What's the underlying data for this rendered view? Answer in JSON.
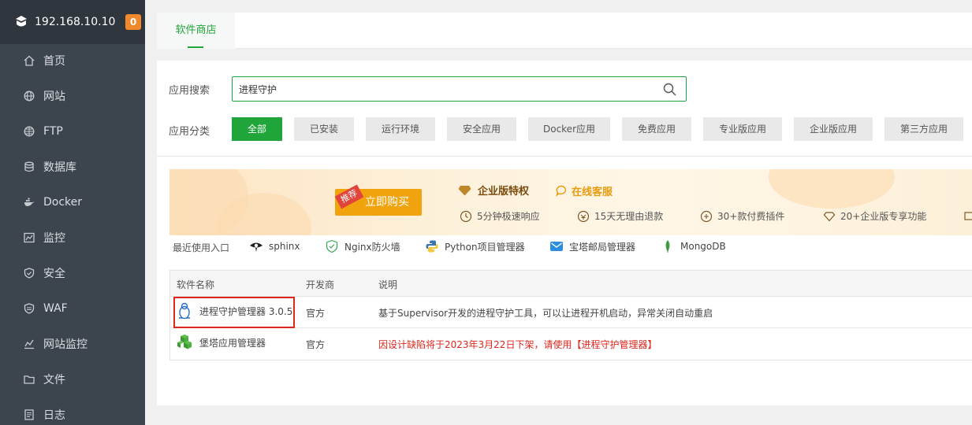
{
  "sidebar": {
    "ip": "192.168.10.10",
    "badge": "0",
    "items": [
      {
        "label": "首页",
        "icon": "home-icon"
      },
      {
        "label": "网站",
        "icon": "globe-icon"
      },
      {
        "label": "FTP",
        "icon": "ftp-globe-icon"
      },
      {
        "label": "数据库",
        "icon": "database-icon"
      },
      {
        "label": "Docker",
        "icon": "docker-icon"
      },
      {
        "label": "监控",
        "icon": "monitor-icon"
      },
      {
        "label": "安全",
        "icon": "shield-icon"
      },
      {
        "label": "WAF",
        "icon": "waf-shield-icon"
      },
      {
        "label": "网站监控",
        "icon": "chart-icon"
      },
      {
        "label": "文件",
        "icon": "folder-icon"
      },
      {
        "label": "日志",
        "icon": "log-icon"
      }
    ]
  },
  "tabs": [
    {
      "label": "软件商店"
    }
  ],
  "search": {
    "label": "应用搜索",
    "value": "进程守护"
  },
  "categories": {
    "label": "应用分类",
    "items": [
      "全部",
      "已安装",
      "运行环境",
      "安全应用",
      "Docker应用",
      "免费应用",
      "专业版应用",
      "企业版应用",
      "第三方应用"
    ]
  },
  "banner": {
    "ribbon": "推荐",
    "buy": "立即购买",
    "title": "企业版特权",
    "online": "在线客服",
    "features": [
      "5分钟极速响应",
      "15天无理由退款",
      "30+款付费插件",
      "20+企业版专享功能"
    ]
  },
  "recent": {
    "label": "最近使用入口",
    "items": [
      {
        "label": "sphinx",
        "icon": "eye-icon"
      },
      {
        "label": "Nginx防火墙",
        "icon": "nginx-shield-icon"
      },
      {
        "label": "Python项目管理器",
        "icon": "python-icon"
      },
      {
        "label": "宝塔邮局管理器",
        "icon": "mail-icon"
      },
      {
        "label": "MongoDB",
        "icon": "mongodb-leaf-icon"
      }
    ]
  },
  "table": {
    "headers": [
      "软件名称",
      "开发商",
      "说明"
    ],
    "rows": [
      {
        "name": "进程守护管理器 3.0.5",
        "vendor": "官方",
        "desc": "基于Supervisor开发的进程守护工具，可以让进程开机启动，异常关闭自动重启",
        "icon": "linux-penguin-icon"
      },
      {
        "name": "堡塔应用管理器",
        "vendor": "官方",
        "desc": "因设计缺陷将于2023年3月22日下架，请使用【进程守护管理器】",
        "icon": "cube-icon"
      }
    ]
  },
  "colors": {
    "accent": "#20a53a",
    "sidebar": "#3c444d",
    "warning": "#e1261c",
    "buy": "#f1a30e"
  }
}
